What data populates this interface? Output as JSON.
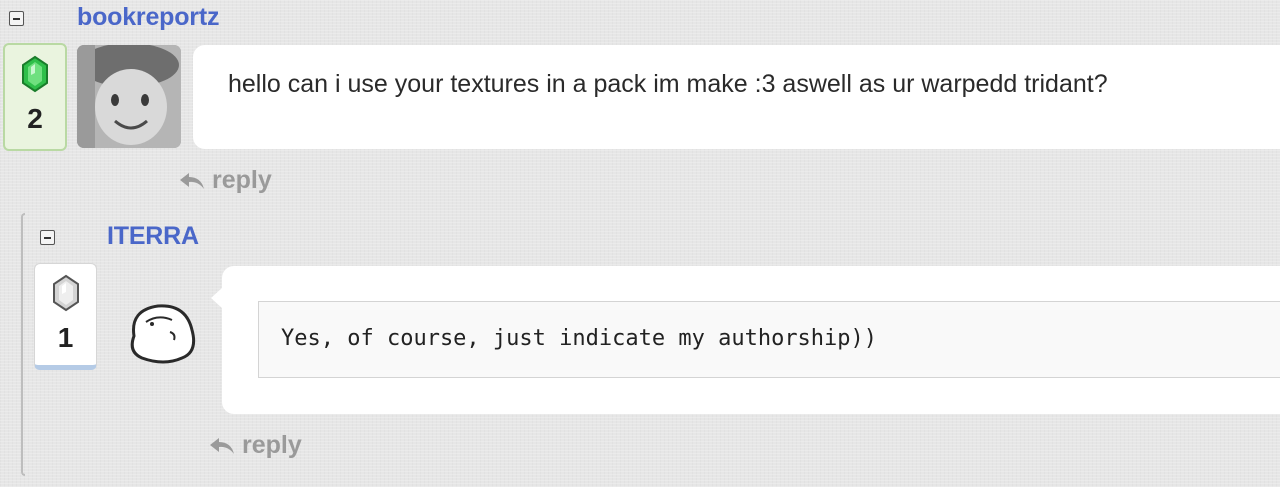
{
  "comments": [
    {
      "username": "bookreportz",
      "vote_count": "2",
      "vote_gem": "emerald-gem-icon",
      "message": "hello can i use your textures in a pack im make :3 aswell as ur warpedd tridant?",
      "reply_label": "reply"
    },
    {
      "username": "ITERRA",
      "vote_count": "1",
      "vote_gem": "silver-gem-icon",
      "message": "Yes, of course, just indicate my authorship))",
      "reply_label": "reply"
    }
  ],
  "colors": {
    "username": "#4a67c9",
    "reply": "#9a9a9a",
    "emerald": "#2fbf4a",
    "background": "#e6e6e6"
  }
}
